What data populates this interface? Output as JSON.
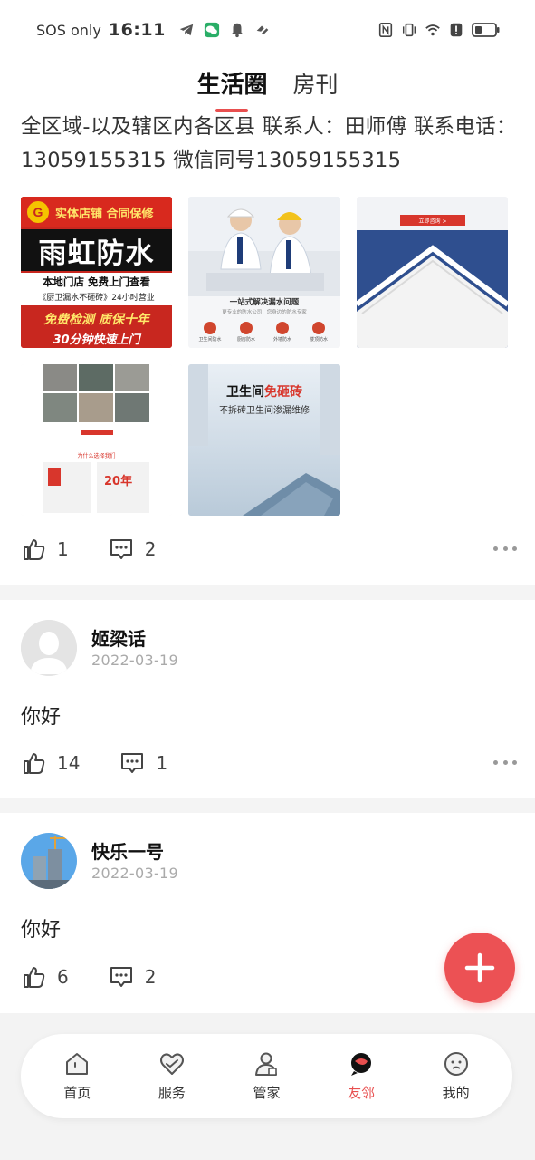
{
  "status_bar": {
    "carrier": "SOS only",
    "time": "16:11",
    "battery_icon": "battery-icon"
  },
  "tabs": [
    {
      "label": "生活圈",
      "active": true
    },
    {
      "label": "房刊",
      "active": false
    }
  ],
  "post": {
    "text": "全区域-以及辖区内各区县 联系人：田师傅 联系电话：13059155315 微信同号13059155315",
    "images": [
      {
        "banner": "实体店铺 合同保修",
        "title": "雨虹防水",
        "line1": "本地门店  免费上门查看",
        "line2": "《厨卫漏水不砸砖》24小时营业",
        "line3": "免费检测 质保十年",
        "line4": "30分钟快速上门"
      },
      {
        "caption": "一站式解决漏水问题",
        "sub": "更专业的防水公司，您身边的防水专家",
        "items": [
          "卫生间防水",
          "厨房防水",
          "外墙防水",
          "楼顶防水"
        ]
      },
      {
        "button": "立即咨询 >"
      },
      {
        "note": "为什么选择我们",
        "badge": "20年"
      },
      {
        "title_a": "卫生间",
        "title_b": "免砸砖",
        "subtitle": "不拆砖卫生间渗漏维修"
      }
    ],
    "likes": "1",
    "comments": "2"
  },
  "feed": [
    {
      "author": "姬梁话",
      "date": "2022-03-19",
      "text": "你好",
      "likes": "14",
      "comments": "1"
    },
    {
      "author": "快乐一号",
      "date": "2022-03-19",
      "text": "你好",
      "likes": "6",
      "comments": "2"
    }
  ],
  "bottom_nav": [
    {
      "label": "首页",
      "icon": "home-icon",
      "active": false
    },
    {
      "label": "服务",
      "icon": "service-heart-icon",
      "active": false
    },
    {
      "label": "管家",
      "icon": "butler-icon",
      "active": false
    },
    {
      "label": "友邻",
      "icon": "neighbor-chat-icon",
      "active": true
    },
    {
      "label": "我的",
      "icon": "profile-icon",
      "active": false
    }
  ],
  "colors": {
    "accent": "#e84f4f",
    "fab": "#ec5154",
    "divider": "#f4f4f4"
  }
}
